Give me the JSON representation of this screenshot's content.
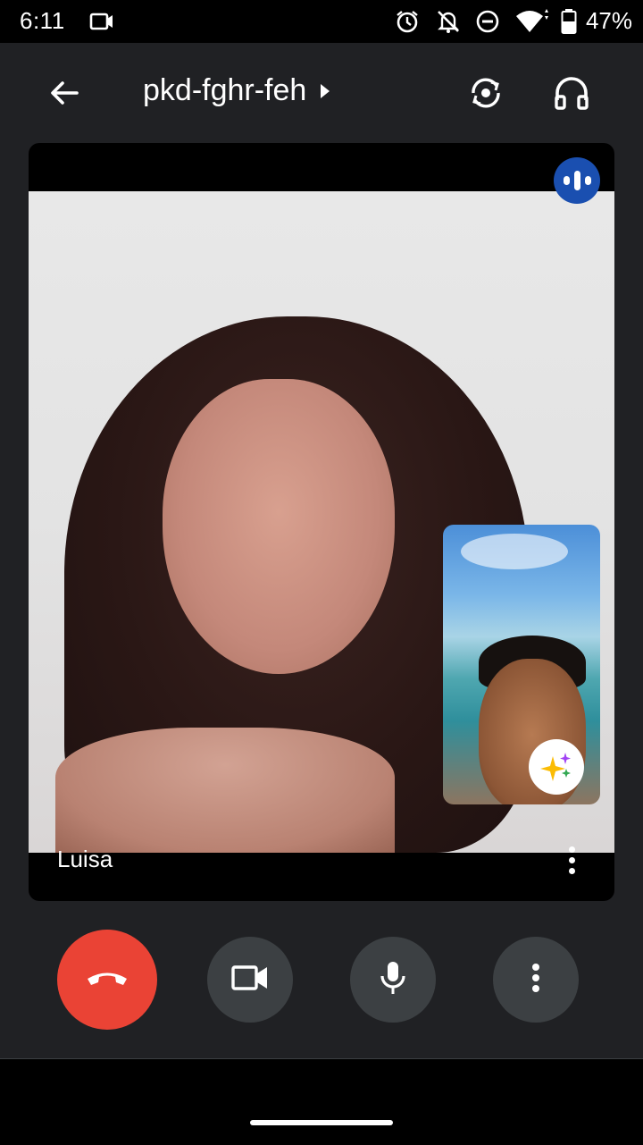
{
  "status_bar": {
    "time": "6:11",
    "battery_percent": "47%",
    "icons": [
      "screen-record-icon",
      "alarm-icon",
      "notifications-off-icon",
      "do-not-disturb-icon",
      "wifi-icon",
      "battery-icon"
    ]
  },
  "app_bar": {
    "meeting_code": "pkd-fghr-feh",
    "back_icon": "arrow-back-icon",
    "switch_camera_icon": "switch-camera-icon",
    "audio_output_icon": "headphones-icon"
  },
  "main_video": {
    "participant_name": "Luisa",
    "speaking_indicator_icon": "audio-wave-icon",
    "menu_icon": "more-vert-icon"
  },
  "self_view": {
    "effects_icon": "sparkle-effects-icon"
  },
  "controls": {
    "end_call_icon": "call-end-icon",
    "camera_icon": "videocam-icon",
    "mic_icon": "mic-icon",
    "more_icon": "more-vert-icon"
  },
  "colors": {
    "background": "#202124",
    "end_call_red": "#ea4335",
    "control_gray": "#3c4043",
    "speaking_blue": "#1a4fb0"
  }
}
